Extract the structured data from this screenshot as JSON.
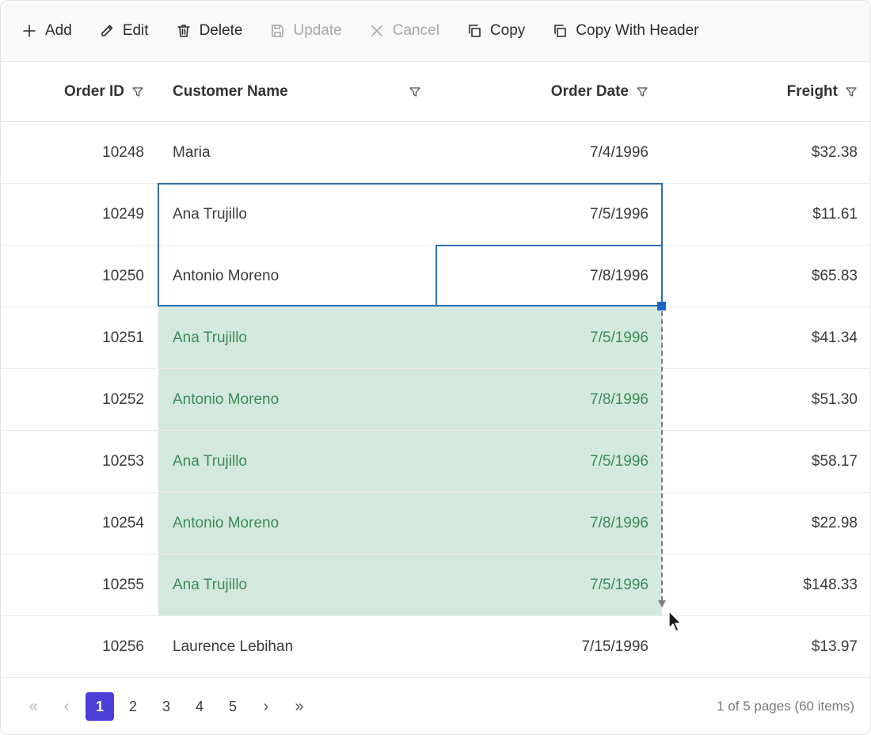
{
  "toolbar": {
    "add": "Add",
    "edit": "Edit",
    "delete": "Delete",
    "update": "Update",
    "cancel": "Cancel",
    "copy": "Copy",
    "copy_with_header": "Copy With Header"
  },
  "columns": {
    "order_id": "Order ID",
    "customer_name": "Customer Name",
    "order_date": "Order Date",
    "freight": "Freight"
  },
  "rows": [
    {
      "id": "10248",
      "name": "Maria",
      "date": "7/4/1996",
      "freight": "$32.38"
    },
    {
      "id": "10249",
      "name": "Ana Trujillo",
      "date": "7/5/1996",
      "freight": "$11.61"
    },
    {
      "id": "10250",
      "name": "Antonio Moreno",
      "date": "7/8/1996",
      "freight": "$65.83"
    },
    {
      "id": "10251",
      "name": "Ana Trujillo",
      "date": "7/5/1996",
      "freight": "$41.34"
    },
    {
      "id": "10252",
      "name": "Antonio Moreno",
      "date": "7/8/1996",
      "freight": "$51.30"
    },
    {
      "id": "10253",
      "name": "Ana Trujillo",
      "date": "7/5/1996",
      "freight": "$58.17"
    },
    {
      "id": "10254",
      "name": "Antonio Moreno",
      "date": "7/8/1996",
      "freight": "$22.98"
    },
    {
      "id": "10255",
      "name": "Ana Trujillo",
      "date": "7/5/1996",
      "freight": "$148.33"
    },
    {
      "id": "10256",
      "name": "Laurence Lebihan",
      "date": "7/15/1996",
      "freight": "$13.97"
    }
  ],
  "pager": {
    "first": "«",
    "prev": "‹",
    "pages": [
      "1",
      "2",
      "3",
      "4",
      "5"
    ],
    "next": "›",
    "last": "»",
    "current": "1",
    "info": "1 of 5 pages (60 items)"
  },
  "colors": {
    "selection_border": "#2f6fad",
    "fill_background": "#d4e9dd",
    "fill_text": "#3d8a5a",
    "active_page": "#4b3fd8"
  }
}
